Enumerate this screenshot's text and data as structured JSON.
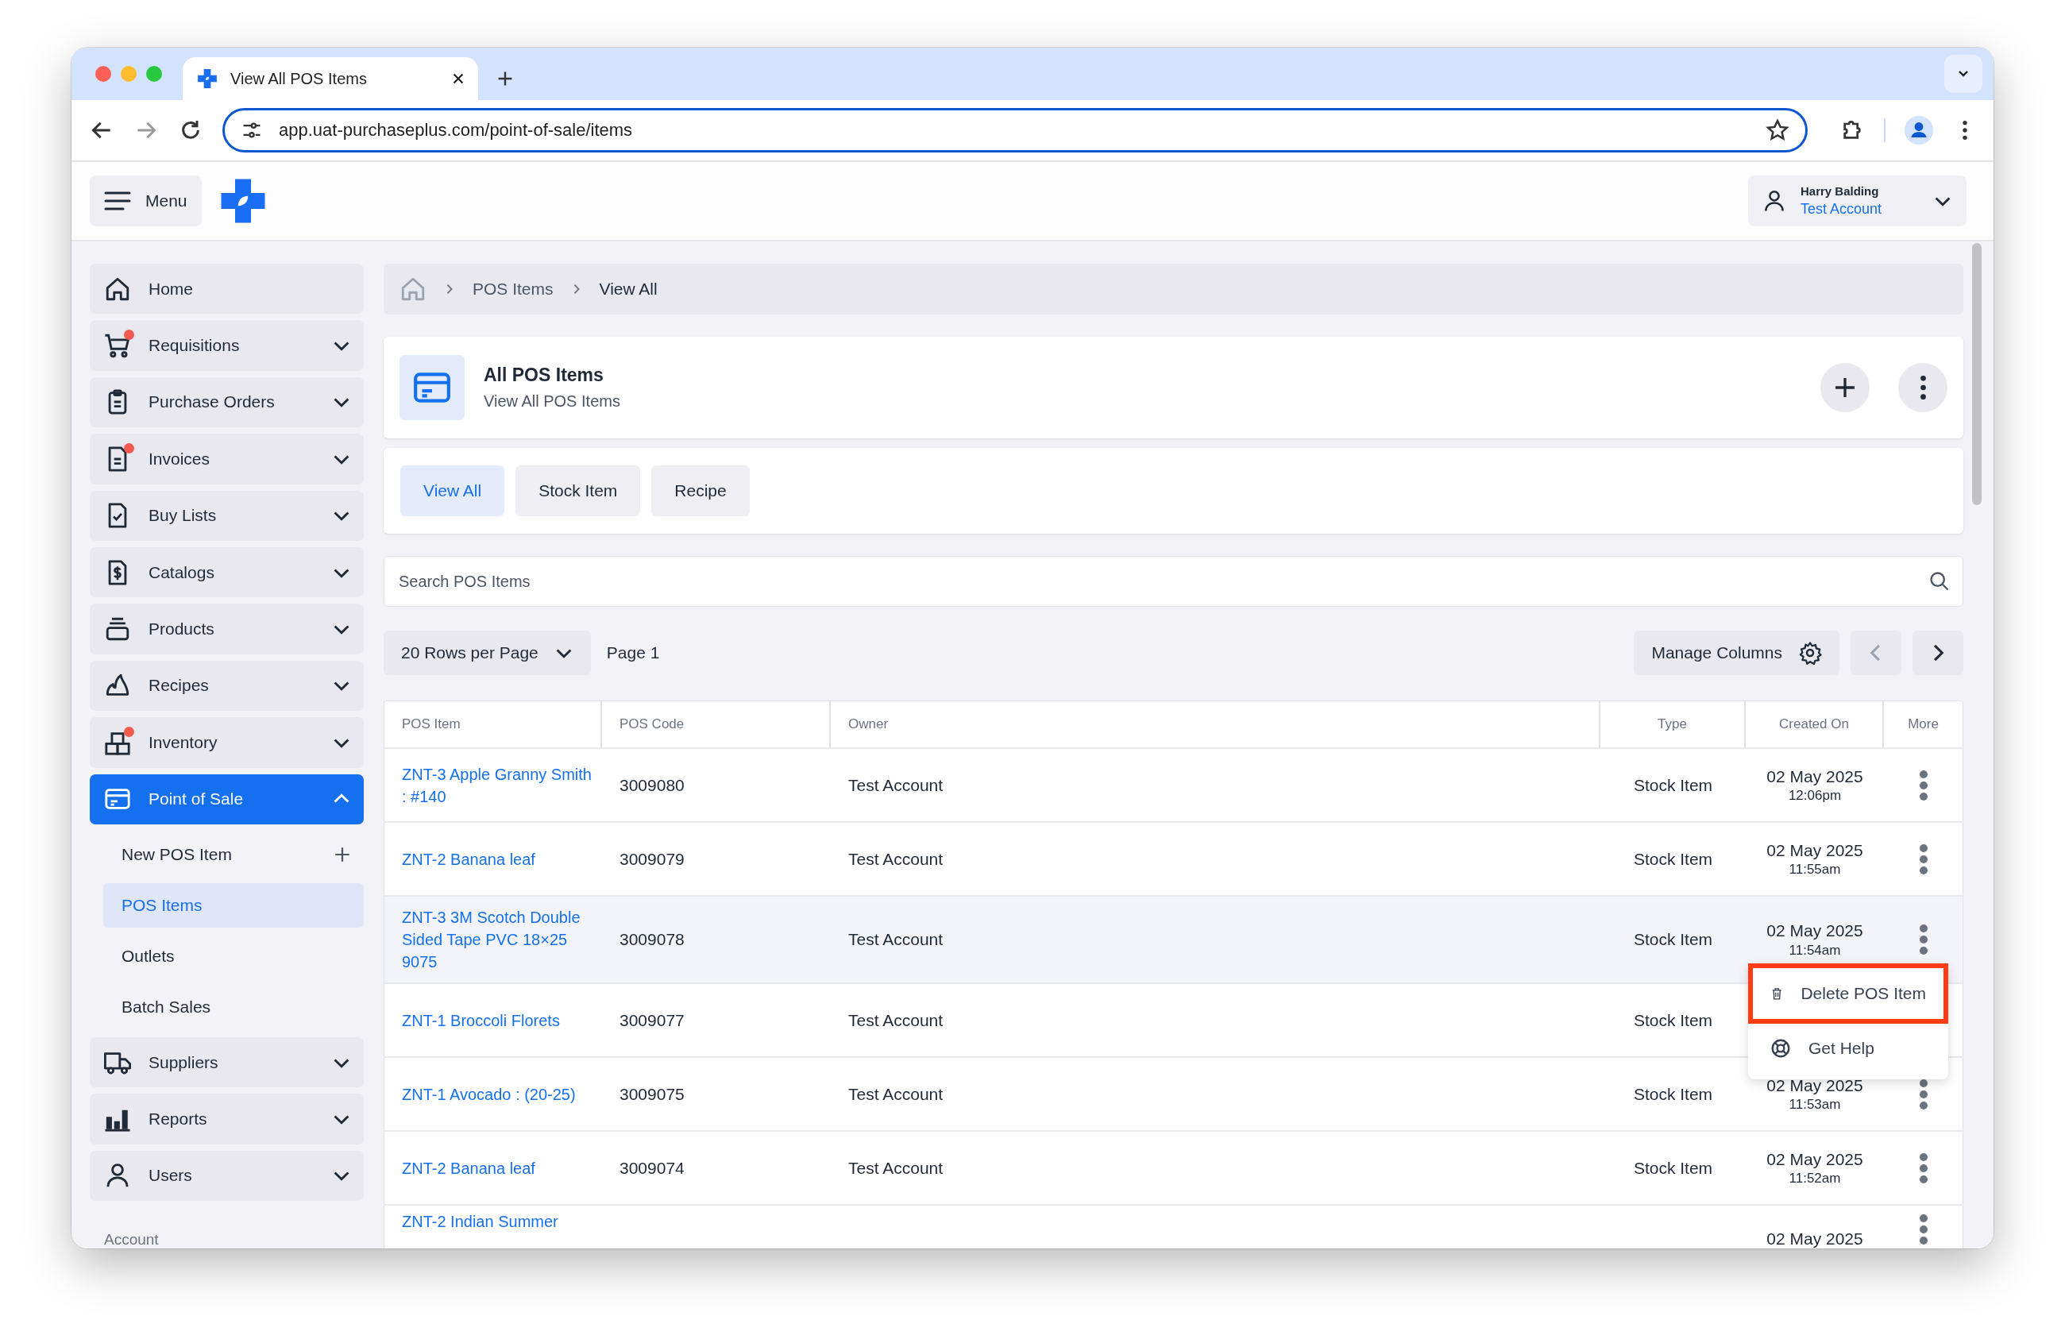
{
  "browser": {
    "tab_title": "View All POS Items",
    "url": "app.uat-purchaseplus.com/point-of-sale/items"
  },
  "header": {
    "menu_label": "Menu",
    "user": {
      "name": "Harry Balding",
      "account": "Test Account"
    }
  },
  "sidebar": {
    "items": [
      {
        "label": "Home",
        "kind": "link",
        "badge": false,
        "selected": false
      },
      {
        "label": "Requisitions",
        "kind": "group",
        "badge": true,
        "selected": false,
        "expanded": false
      },
      {
        "label": "Purchase Orders",
        "kind": "group",
        "badge": false,
        "selected": false,
        "expanded": false
      },
      {
        "label": "Invoices",
        "kind": "group",
        "badge": true,
        "selected": false,
        "expanded": false
      },
      {
        "label": "Buy Lists",
        "kind": "group",
        "badge": false,
        "selected": false,
        "expanded": false
      },
      {
        "label": "Catalogs",
        "kind": "group",
        "badge": false,
        "selected": false,
        "expanded": false
      },
      {
        "label": "Products",
        "kind": "group",
        "badge": false,
        "selected": false,
        "expanded": false
      },
      {
        "label": "Recipes",
        "kind": "group",
        "badge": false,
        "selected": false,
        "expanded": false
      },
      {
        "label": "Inventory",
        "kind": "group",
        "badge": true,
        "selected": false,
        "expanded": false
      },
      {
        "label": "Point of Sale",
        "kind": "group",
        "badge": false,
        "selected": true,
        "expanded": true,
        "children": [
          {
            "label": "New POS Item",
            "kind": "add",
            "selected": false
          },
          {
            "label": "POS Items",
            "kind": "link",
            "selected": true
          },
          {
            "label": "Outlets",
            "kind": "link",
            "selected": false
          },
          {
            "label": "Batch Sales",
            "kind": "link",
            "selected": false
          }
        ]
      },
      {
        "label": "Suppliers",
        "kind": "group",
        "badge": false,
        "selected": false,
        "expanded": false
      },
      {
        "label": "Reports",
        "kind": "group",
        "badge": false,
        "selected": false,
        "expanded": false
      },
      {
        "label": "Users",
        "kind": "group",
        "badge": false,
        "selected": false,
        "expanded": false
      }
    ],
    "section_label": "Account"
  },
  "breadcrumb": [
    "POS Items",
    "View All"
  ],
  "page_header": {
    "title": "All POS Items",
    "subtitle": "View All POS Items"
  },
  "filter_tabs": [
    {
      "label": "View All",
      "selected": true
    },
    {
      "label": "Stock Item",
      "selected": false
    },
    {
      "label": "Recipe",
      "selected": false
    }
  ],
  "search": {
    "placeholder": "Search POS Items"
  },
  "pagination": {
    "rows_per_page": "20 Rows per Page",
    "page": "Page 1",
    "manage_columns": "Manage Columns",
    "prev_disabled": true,
    "next_disabled": false
  },
  "table": {
    "columns": [
      "POS Item",
      "POS Code",
      "Owner",
      "Type",
      "Created On",
      "More"
    ],
    "rows": [
      {
        "item": "ZNT-3 Apple Granny Smith : #140",
        "code": "3009080",
        "owner": "Test Account",
        "type": "Stock Item",
        "date": "02 May 2025",
        "time": "12:06pm",
        "highlighted": false
      },
      {
        "item": "ZNT-2 Banana leaf",
        "code": "3009079",
        "owner": "Test Account",
        "type": "Stock Item",
        "date": "02 May 2025",
        "time": "11:55am",
        "highlighted": false
      },
      {
        "item": "ZNT-3 3M Scotch Double Sided Tape PVC 18×25 9075",
        "code": "3009078",
        "owner": "Test Account",
        "type": "Stock Item",
        "date": "02 May 2025",
        "time": "11:54am",
        "highlighted": true,
        "menu": [
          {
            "label": "Delete POS Item",
            "highlighted": true
          },
          {
            "label": "Get Help",
            "highlighted": false
          }
        ]
      },
      {
        "item": "ZNT-1 Broccoli Florets",
        "code": "3009077",
        "owner": "Test Account",
        "type": "Stock Item",
        "highlighted": false
      },
      {
        "item": "ZNT-1 Avocado : (20-25)",
        "code": "3009075",
        "owner": "Test Account",
        "type": "Stock Item",
        "date": "02 May 2025",
        "time": "11:53am",
        "highlighted": false
      },
      {
        "item": "ZNT-2 Banana leaf",
        "code": "3009074",
        "owner": "Test Account",
        "type": "Stock Item",
        "date": "02 May 2025",
        "time": "11:52am",
        "highlighted": false
      },
      {
        "item": "ZNT-2 Indian Summer",
        "date": "02 May 2025",
        "highlighted": false
      }
    ]
  }
}
